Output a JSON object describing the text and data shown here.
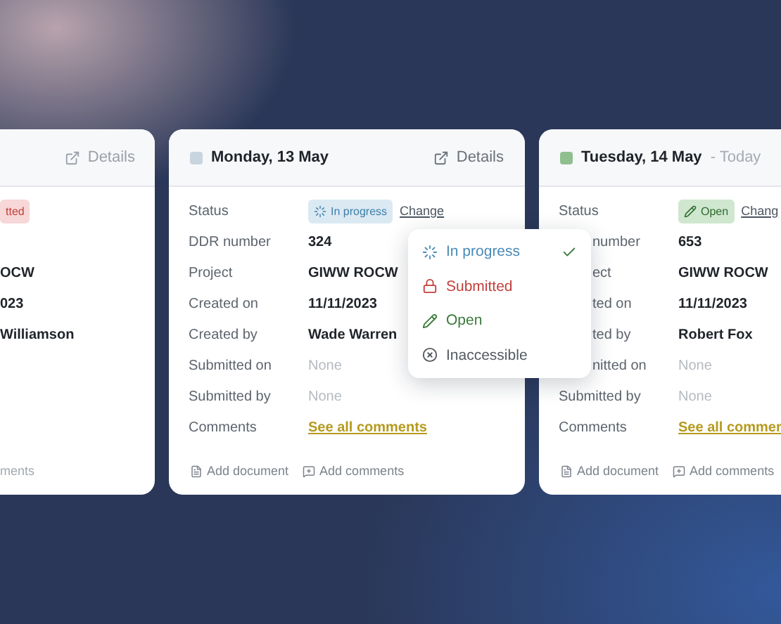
{
  "cards": [
    {
      "kind": "clipped-left",
      "details": "Details",
      "rows": [
        {
          "kind": "badge",
          "badge": {
            "text": "tted",
            "kind": "submitted"
          }
        },
        {
          "kind": "blank"
        },
        {
          "kind": "text",
          "value": "OCW"
        },
        {
          "kind": "text",
          "value": "023"
        },
        {
          "kind": "text",
          "value": "Williamson"
        },
        {
          "kind": "blank"
        },
        {
          "kind": "blank"
        },
        {
          "kind": "blank"
        }
      ],
      "footer": [
        {
          "kind": "plain",
          "label": "ments"
        }
      ]
    },
    {
      "kind": "full",
      "color": "#c8d5de",
      "title": "Monday, 13 May",
      "details": "Details",
      "rows": [
        {
          "kind": "badge",
          "label": "Status",
          "badge": {
            "text": "In progress",
            "kind": "progress"
          },
          "action": "Change"
        },
        {
          "kind": "text",
          "label": "DDR number",
          "value": "324"
        },
        {
          "kind": "text",
          "label": "Project",
          "value": "GIWW ROCW"
        },
        {
          "kind": "text",
          "label": "Created on",
          "value": "11/11/2023"
        },
        {
          "kind": "text",
          "label": "Created by",
          "value": "Wade Warren"
        },
        {
          "kind": "none",
          "label": "Submitted on",
          "value": "None"
        },
        {
          "kind": "none",
          "label": "Submitted by",
          "value": "None"
        },
        {
          "kind": "link",
          "label": "Comments",
          "value": "See all comments"
        }
      ],
      "footer": [
        {
          "kind": "document",
          "label": "Add document"
        },
        {
          "kind": "comment",
          "label": "Add comments"
        }
      ],
      "menu": {
        "items": [
          {
            "label": "In progress",
            "kind": "progress",
            "color": "#4a8bb5",
            "selected": true
          },
          {
            "label": "Submitted",
            "kind": "lock",
            "color": "#c2403c",
            "selected": false
          },
          {
            "label": "Open",
            "kind": "pencil",
            "color": "#3d7a3d",
            "selected": false
          },
          {
            "label": "Inaccessible",
            "kind": "blocked",
            "color": "#555a62",
            "selected": false
          }
        ]
      }
    },
    {
      "kind": "clipped-right",
      "color": "#8fbf8f",
      "title": "Tuesday, 14 May",
      "suffix": "- Today",
      "rows": [
        {
          "kind": "badge",
          "label": "Status",
          "badge": {
            "text": "Open",
            "kind": "open"
          },
          "action": "Chang"
        },
        {
          "kind": "text",
          "label": "number",
          "covered": true,
          "value": "653"
        },
        {
          "kind": "text",
          "label": "ect",
          "covered": true,
          "value": "GIWW ROCW"
        },
        {
          "kind": "text",
          "label": "ted on",
          "covered": true,
          "value": "11/11/2023"
        },
        {
          "kind": "text",
          "label": "ted by",
          "covered": true,
          "value": "Robert Fox"
        },
        {
          "kind": "none",
          "label": "nitted on",
          "covered": true,
          "value": "None"
        },
        {
          "kind": "none",
          "label": "Submitted by",
          "value": "None"
        },
        {
          "kind": "link",
          "label": "Comments",
          "value": "See all commer"
        }
      ],
      "footer": [
        {
          "kind": "document",
          "label": "Add document"
        },
        {
          "kind": "comment",
          "label": "Add comments"
        }
      ]
    }
  ]
}
